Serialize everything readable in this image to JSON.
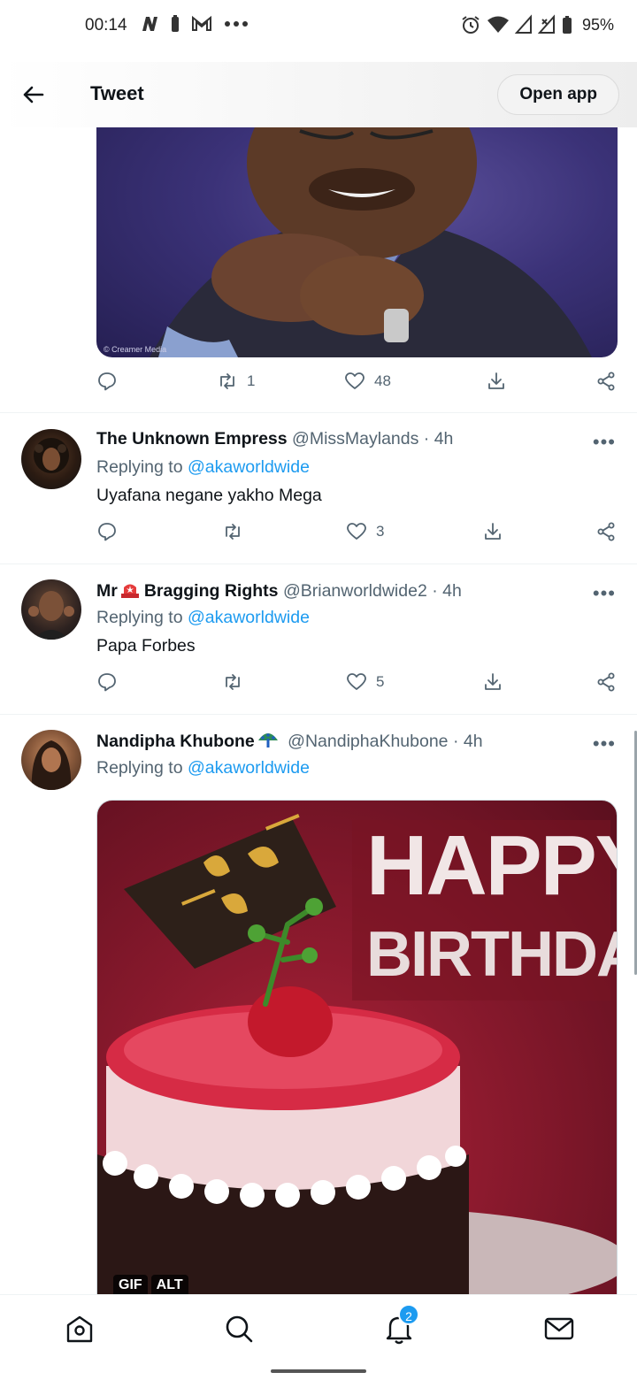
{
  "status_bar": {
    "time": "00:14",
    "battery": "95%"
  },
  "header": {
    "title": "Tweet",
    "open_app": "Open app"
  },
  "main_tweet": {
    "image_credit": "© Creamer Media",
    "retweets": "1",
    "likes": "48"
  },
  "replies": [
    {
      "name": "The Unknown Empress",
      "handle": "@MissMaylands",
      "time": "· 4h",
      "replying_prefix": "Replying to",
      "replying_to": "@akaworldwide",
      "text": "Uyafana negane yakho Mega",
      "retweets": "",
      "likes": "3"
    },
    {
      "name_prefix": "Mr",
      "name": "Bragging Rights",
      "handle": "@Brianworldwide2",
      "time": "· 4h",
      "replying_prefix": "Replying to",
      "replying_to": "@akaworldwide",
      "text": "Papa Forbes",
      "retweets": "",
      "likes": "5"
    },
    {
      "name": "Nandipha Khubone",
      "handle": "@NandiphaKhubone",
      "time": "· 4h",
      "replying_prefix": "Replying to",
      "replying_to": "@akaworldwide",
      "gif_line1": "HAPPY",
      "gif_line2": "BIRTHDAY",
      "badge_gif": "GIF",
      "badge_alt": "ALT"
    }
  ],
  "bottom_nav": {
    "notifications_count": "2"
  },
  "colors": {
    "accent": "#1d9bf0",
    "secondary_text": "#536471"
  }
}
